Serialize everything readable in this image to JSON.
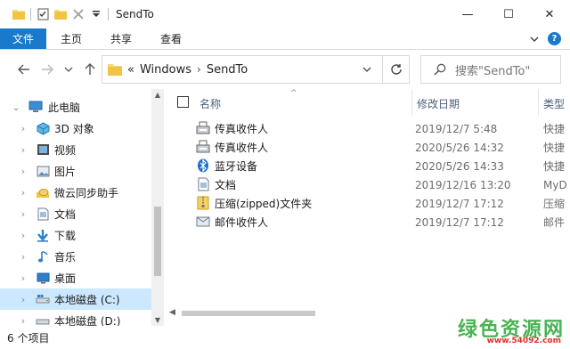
{
  "window": {
    "title": "SendTo",
    "minimize": "—",
    "maximize": "☐",
    "close": "✕"
  },
  "ribbon": {
    "tabs": [
      "文件",
      "主页",
      "共享",
      "查看"
    ],
    "help": "?"
  },
  "address": {
    "overflow": "«",
    "crumbs": [
      "Windows",
      "SendTo"
    ],
    "search_placeholder": "搜索\"SendTo\""
  },
  "sidebar": {
    "items": [
      {
        "label": "此电脑",
        "icon": "computer-icon"
      },
      {
        "label": "3D 对象",
        "icon": "cube-3d-icon"
      },
      {
        "label": "视频",
        "icon": "video-icon"
      },
      {
        "label": "图片",
        "icon": "picture-icon"
      },
      {
        "label": "微云同步助手",
        "icon": "cloud-icon"
      },
      {
        "label": "文档",
        "icon": "document-icon"
      },
      {
        "label": "下载",
        "icon": "download-icon"
      },
      {
        "label": "音乐",
        "icon": "music-icon"
      },
      {
        "label": "桌面",
        "icon": "desktop-icon"
      },
      {
        "label": "本地磁盘 (C:)",
        "icon": "drive-icon"
      },
      {
        "label": "本地磁盘 (D:)",
        "icon": "drive-icon"
      }
    ]
  },
  "columns": {
    "name": "名称",
    "date": "修改日期",
    "type": "类型"
  },
  "files": [
    {
      "name": "传真收件人",
      "date": "2019/12/7 5:48",
      "type": "快捷",
      "icon": "fax-icon"
    },
    {
      "name": "传真收件人",
      "date": "2020/5/26 14:32",
      "type": "快捷",
      "icon": "fax-icon"
    },
    {
      "name": "蓝牙设备",
      "date": "2020/5/26 14:33",
      "type": "快捷",
      "icon": "bluetooth-icon"
    },
    {
      "name": "文档",
      "date": "2019/12/16 13:20",
      "type": "MyD",
      "icon": "document-icon"
    },
    {
      "name": "压缩(zipped)文件夹",
      "date": "2019/12/7 17:12",
      "type": "压缩",
      "icon": "zip-folder-icon"
    },
    {
      "name": "邮件收件人",
      "date": "2019/12/7 17:12",
      "type": "邮件",
      "icon": "mail-icon"
    }
  ],
  "status": {
    "count": "6 个项目"
  },
  "watermark": {
    "text": "绿色资源网",
    "url": "www.54092.com"
  },
  "colors": {
    "accent": "#1979ca",
    "selection": "#cce8ff",
    "folder": "#f8d775"
  }
}
